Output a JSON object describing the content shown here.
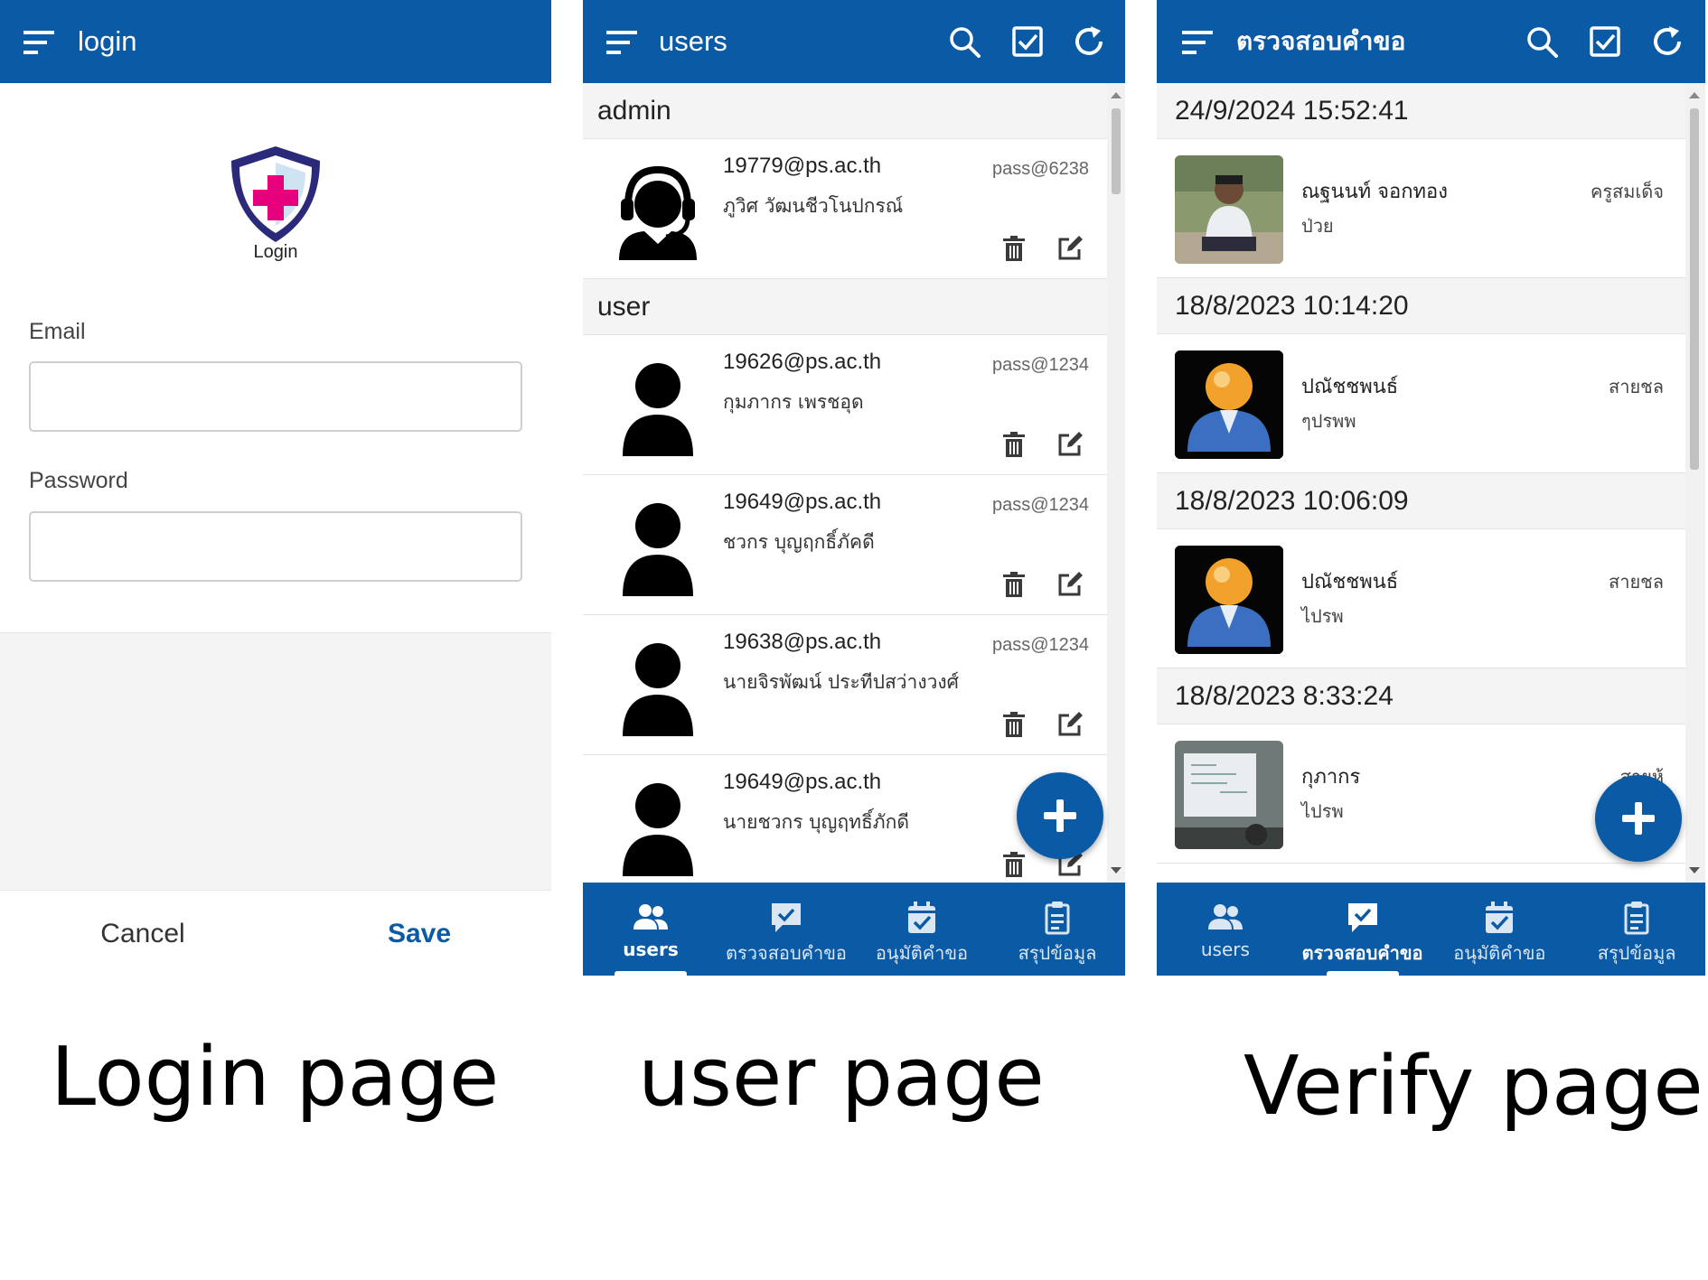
{
  "login_page": {
    "title": "login",
    "logo_text": "Login",
    "email_label": "Email",
    "email_value": "",
    "password_label": "Password",
    "password_value": "",
    "cancel_label": "Cancel",
    "save_label": "Save"
  },
  "users_page": {
    "title": "users",
    "admin_header": "admin",
    "user_header": "user",
    "admin_items": [
      {
        "email": "19779@ps.ac.th",
        "name": "ภูวิศ วัฒนชีวโนปกรณ์",
        "password": "pass@6238",
        "avatar": "headset-person-icon"
      }
    ],
    "user_items": [
      {
        "email": "19626@ps.ac.th",
        "name": "กุมภากร เพรชอุด",
        "password": "pass@1234",
        "avatar": "person-icon"
      },
      {
        "email": "19649@ps.ac.th",
        "name": "ชวกร บุญฤกธิ์ภัคดี",
        "password": "pass@1234",
        "avatar": "person-icon"
      },
      {
        "email": "19638@ps.ac.th",
        "name": "นายจิรพัฒน์ ประทีปสว่างวงศ์",
        "password": "pass@1234",
        "avatar": "person-icon"
      },
      {
        "email": "19649@ps.ac.th",
        "name": "นายชวกร บุญฤทธิ์ภักดี",
        "password": "pass",
        "avatar": "person-icon"
      }
    ]
  },
  "verify_page": {
    "title": "ตรวจสอบคำขอ",
    "groups": [
      {
        "date": "24/9/2024 15:52:41",
        "name": "ณฐนนท์ จอกทอง",
        "sub": "ป่วย",
        "right": "ครูสมเด็จ",
        "thumb": "student-photo"
      },
      {
        "date": "18/8/2023 10:14:20",
        "name": "ปณัชชพนธ์",
        "sub": "ๆปรพพ",
        "right": "สายชล",
        "thumb": "default-user-icon"
      },
      {
        "date": "18/8/2023 10:06:09",
        "name": "ปณัชชพนธ์",
        "sub": "ไปรพ",
        "right": "สายชล",
        "thumb": "default-user-icon"
      },
      {
        "date": "18/8/2023 8:33:24",
        "name": "กุภากร",
        "sub": "ไปรพ",
        "right": "สายห้",
        "thumb": "classroom-photo"
      }
    ]
  },
  "tabs": [
    {
      "label": "users",
      "icon": "people-icon"
    },
    {
      "label": "ตรวจสอบคำขอ",
      "icon": "chat-check-icon"
    },
    {
      "label": "อนุมัติคำขอ",
      "icon": "calendar-check-icon"
    },
    {
      "label": "สรุปข้อมูล",
      "icon": "clipboard-icon"
    }
  ],
  "captions": {
    "login": "Login page",
    "user": "user page",
    "verify": "Verify page"
  },
  "colors": {
    "primary": "#0a5aa6",
    "logo_pink": "#e6007e",
    "logo_navy": "#2b2a7a"
  }
}
